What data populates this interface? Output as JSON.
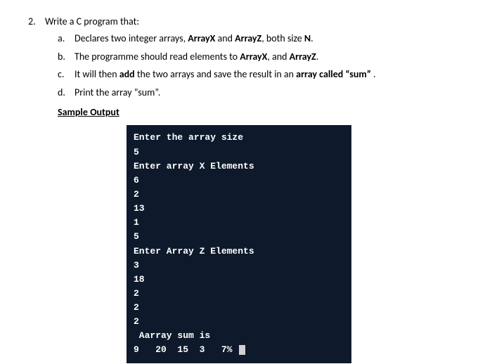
{
  "question": {
    "number": "2.",
    "text_before": "Write a C program that:"
  },
  "items": {
    "a": {
      "letter": "a.",
      "pre": "Declares two integer arrays, ",
      "b1": "ArrayX",
      "mid1": " and ",
      "b2": "ArrayZ",
      "mid2": ", both size ",
      "b3": "N",
      "post": "."
    },
    "b": {
      "letter": "b.",
      "pre": "The programme should read elements to ",
      "b1": "ArrayX",
      "mid1": ", and ",
      "b2": "ArrayZ",
      "post": "."
    },
    "c": {
      "letter": "c.",
      "pre": "It will then ",
      "b1": "add",
      "mid1": " the two arrays and save the result in an ",
      "b2": "array called “sum”",
      "post": " ."
    },
    "d": {
      "letter": "d.",
      "pre": "Print the array “sum”.",
      "post": ""
    }
  },
  "sample_heading": "Sample Output",
  "terminal": {
    "line1": "Enter the array size",
    "line2": "5",
    "line3": "Enter array X Elements",
    "line4": "6",
    "line5": "2",
    "line6": "13",
    "line7": "1",
    "line8": "5",
    "line9": "Enter Array Z Elements",
    "line10": "3",
    "line11": "18",
    "line12": "2",
    "line13": "2",
    "line14": "2",
    "line15": " Aarray sum is",
    "line16": "9   20  15  3   7% "
  }
}
